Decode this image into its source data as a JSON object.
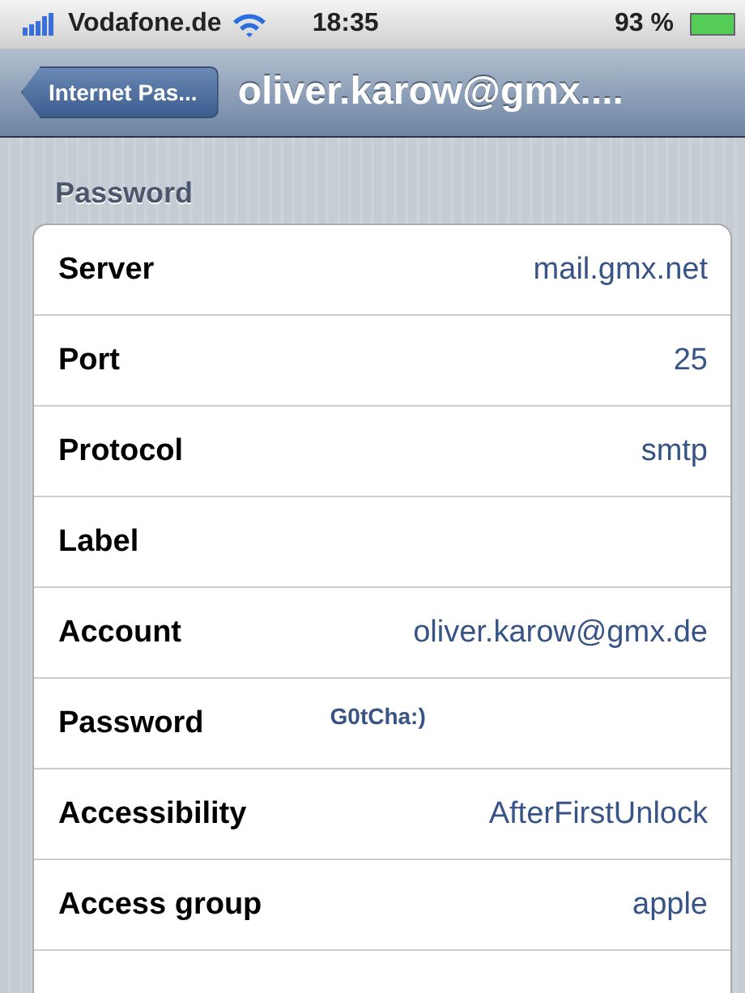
{
  "status_bar": {
    "carrier": "Vodafone.de",
    "time": "18:35",
    "battery": "93 %"
  },
  "nav_bar": {
    "back": "Internet Pas...",
    "title": "oliver.karow@gmx...."
  },
  "section": {
    "header": "Password"
  },
  "rows": [
    {
      "kind": "field",
      "label": "Server",
      "value": "mail.gmx.net"
    },
    {
      "kind": "field",
      "label": "Port",
      "value": "25"
    },
    {
      "kind": "field",
      "label": "Protocol",
      "value": "smtp"
    },
    {
      "kind": "field",
      "label": "Label"
    },
    {
      "kind": "field",
      "label": "Account",
      "value": "oliver.karow@gmx.de"
    },
    {
      "kind": "small",
      "label": "Password",
      "value": "G0tCha:)"
    },
    {
      "kind": "field",
      "label": "Accessibility",
      "value": "AfterFirstUnlock"
    },
    {
      "kind": "field",
      "label": "Access group",
      "value": "apple"
    },
    {
      "kind": "empty"
    }
  ]
}
